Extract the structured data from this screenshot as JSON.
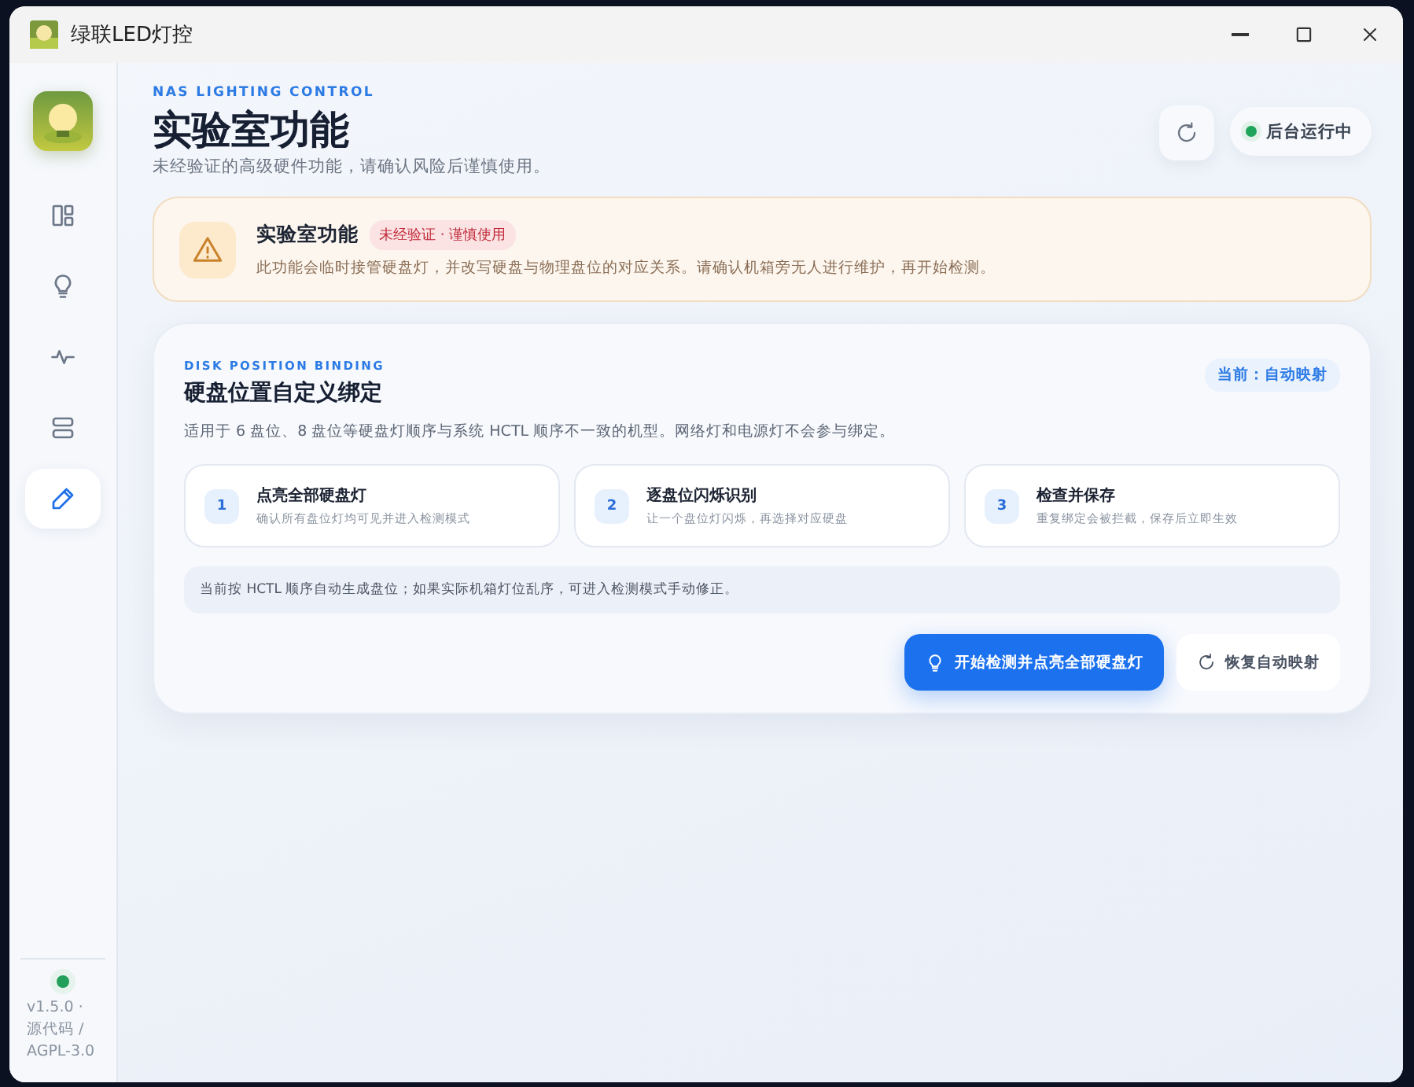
{
  "window": {
    "title": "绿联LED灯控"
  },
  "sidebar": {
    "items": [
      {
        "selected": false
      },
      {
        "selected": false
      },
      {
        "selected": false
      },
      {
        "selected": false
      },
      {
        "selected": true
      }
    ],
    "footer": {
      "online": true,
      "text": "v1.5.0 · 源代码 / AGPL-3.0"
    }
  },
  "header": {
    "eyebrow": "NAS LIGHTING CONTROL",
    "title": "实验室功能",
    "subtitle": "未经验证的高级硬件功能，请确认风险后谨慎使用。",
    "status": {
      "label": "后台运行中",
      "running": true
    }
  },
  "warning": {
    "title": "实验室功能",
    "badge": "未经验证 · 谨慎使用",
    "text": "此功能会临时接管硬盘灯，并改写硬盘与物理盘位的对应关系。请确认机箱旁无人进行维护，再开始检测。"
  },
  "binding": {
    "eyebrow": "DISK POSITION BINDING",
    "title": "硬盘位置自定义绑定",
    "current": "当前：自动映射",
    "description": "适用于 6 盘位、8 盘位等硬盘灯顺序与系统 HCTL 顺序不一致的机型。网络灯和电源灯不会参与绑定。",
    "steps": [
      {
        "number": "1",
        "title": "点亮全部硬盘灯",
        "text": "确认所有盘位灯均可见并进入检测模式"
      },
      {
        "number": "2",
        "title": "逐盘位闪烁识别",
        "text": "让一个盘位灯闪烁，再选择对应硬盘"
      },
      {
        "number": "3",
        "title": "检查并保存",
        "text": "重复绑定会被拦截，保存后立即生效"
      }
    ],
    "note": "当前按 HCTL 顺序自动生成盘位；如果实际机箱灯位乱序，可进入检测模式手动修正。",
    "buttons": [
      {
        "kind": "primary",
        "label": "开始检测并点亮全部硬盘灯"
      },
      {
        "kind": "secondary",
        "label": "恢复自动映射"
      }
    ]
  }
}
